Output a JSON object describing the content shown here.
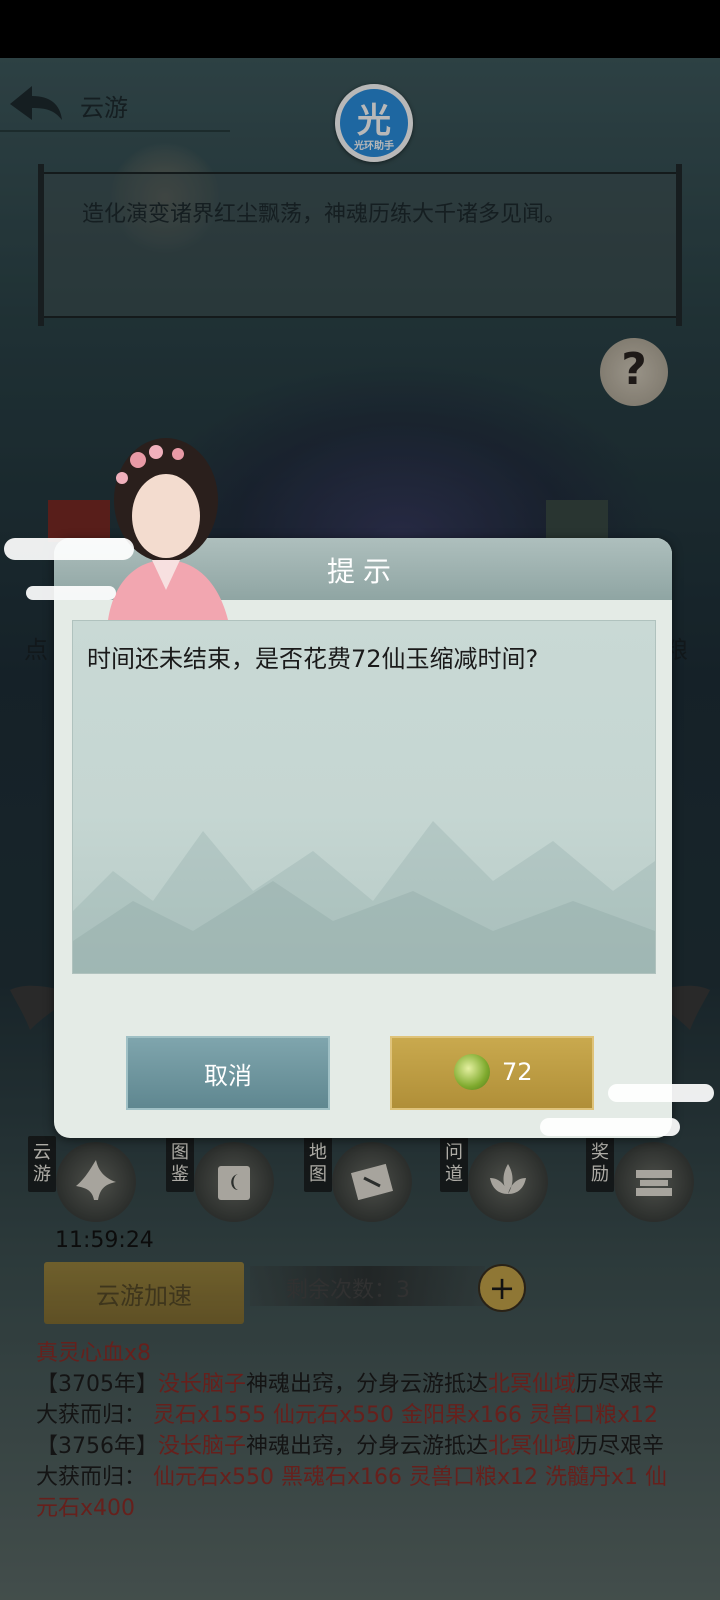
{
  "topbar": {
    "title": "云游"
  },
  "badge": {
    "glyph": "光",
    "text": "光环助手"
  },
  "intro": {
    "text": "造化演变诸界红尘飘荡，神魂历练大千诸多见闻。"
  },
  "help": {
    "glyph": "?"
  },
  "side_text": {
    "left": "点",
    "right": "粮"
  },
  "nav": [
    {
      "label": "云游",
      "icon": "crane-icon"
    },
    {
      "label": "图鉴",
      "icon": "book-icon"
    },
    {
      "label": "地图",
      "icon": "scroll-map-icon"
    },
    {
      "label": "问道",
      "icon": "lotus-icon"
    },
    {
      "label": "奖励",
      "icon": "chest-icon"
    }
  ],
  "timer": "11:59:24",
  "speed_button": "云游加速",
  "remaining": {
    "label": "剩余次数：",
    "value": "3"
  },
  "log": {
    "line0": "真灵心血x8",
    "e1_year": "【3705年】",
    "e1_name": "没长脑子",
    "e1_mid": "神魂出窍，分身云游抵达",
    "e1_place": "北冥仙域",
    "e1_tail": "历尽艰辛大获而归：",
    "e1_items": "灵石x1555 仙元石x550 金阳果x166 灵兽口粮x12",
    "e2_year": "【3756年】",
    "e2_name": "没长脑子",
    "e2_mid": "神魂出窍，分身云游抵达",
    "e2_place": "北冥仙域",
    "e2_tail": "历尽艰辛大获而归：",
    "e2_items": "仙元石x550 黑魂石x166 灵兽口粮x12 洗髓丹x1 仙元石x400"
  },
  "dialog": {
    "title": "提示",
    "message": "时间还未结束，是否花费72仙玉缩减时间?",
    "cancel": "取消",
    "confirm_amount": "72"
  },
  "colors": {
    "accent_gold": "#c9a94e",
    "cancel_teal": "#6f97a0",
    "log_red": "#8e2d28"
  }
}
